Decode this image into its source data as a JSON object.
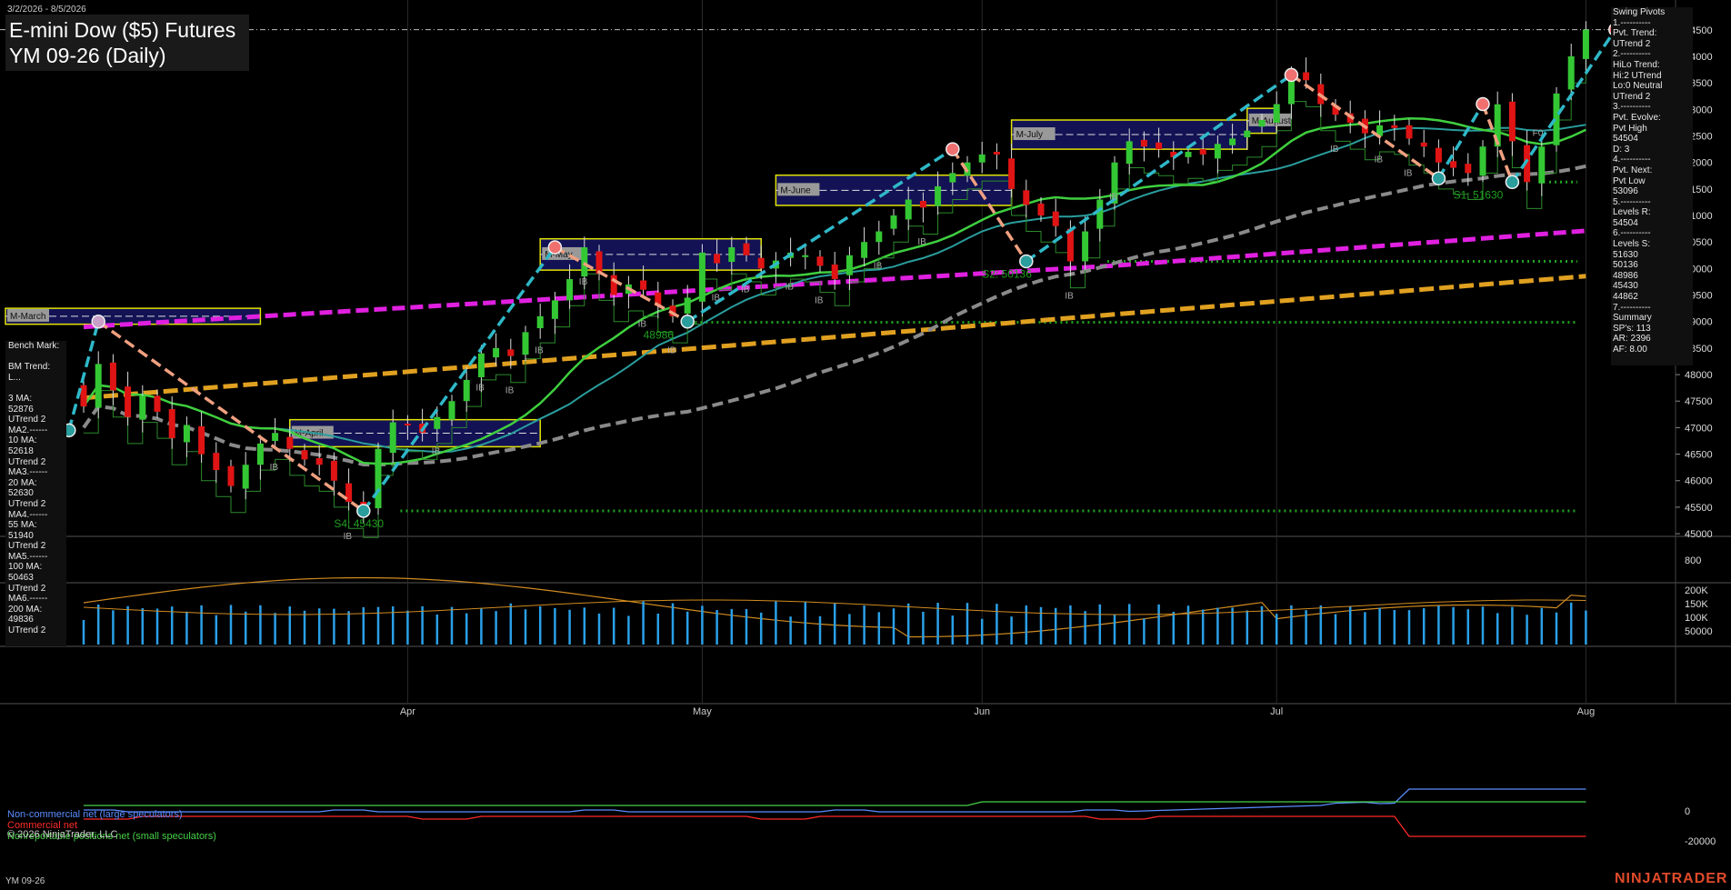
{
  "header": {
    "date_range": "3/2/2026 - 8/5/2026",
    "title": "E-mini Dow ($5) Futures",
    "subtitle": "YM 09-26 (Daily)"
  },
  "footer": {
    "symbol": "YM 09-26",
    "copyright": "© 2026 NinjaTrader, LLC",
    "brand": "NINJATRADER"
  },
  "swing_pivots_panel": {
    "lines": [
      "Swing Pivots",
      "1.----------",
      "Pvt. Trend:",
      "UTrend 2",
      "2.----------",
      "HiLo Trend:",
      "Hi:2 UTrend",
      "Lo:0 Neutral",
      "UTrend 2",
      "3.----------",
      "Pvt. Evolve:",
      "Pvt High",
      "54504",
      "D: 3",
      "4.----------",
      "Pvt. Next:",
      "Pvt Low",
      "53096",
      "5.----------",
      "Levels R:",
      "54504",
      "6.----------",
      "Levels S:",
      "51630",
      "50136",
      "48986",
      "45430",
      "44862",
      "7.----------",
      "Summary",
      "SP's: 113",
      "AR: 2396",
      "AF: 8.00"
    ]
  },
  "bench_panel": {
    "lines": [
      "Bench Mark:",
      "",
      "BM Trend:",
      "L...",
      "",
      "3 MA:",
      "52876",
      "UTrend 2",
      "MA2.------",
      "10 MA:",
      "52618",
      "UTrend 2",
      "MA3.------",
      "20 MA:",
      "52630",
      "UTrend 2",
      "MA4.------",
      "55 MA:",
      "51940",
      "UTrend 2",
      "MA5.------",
      "100 MA:",
      "50463",
      "UTrend 2",
      "MA6.------",
      "200 MA:",
      "49836",
      "UTrend 2"
    ]
  },
  "cot_legend": {
    "noncommercial": "Non-commercial net (large speculators)",
    "commercial": "Commercial net",
    "nonreportable": "Nonreportable positions net (small speculators)"
  },
  "colors": {
    "up_candle": "#34c734",
    "down_candle": "#e01414",
    "ma_green": "#3fcf3f",
    "ma_teal": "#2a9d9d",
    "ma_gray": "#8a8a8a",
    "ma_magenta": "#e020e0",
    "ma_orange": "#e0a020",
    "trend_cyan": "#2fb8c8",
    "trend_salmon": "#f0a080",
    "box_border": "#f0f000",
    "box_fill": "#14145a",
    "support": "#1f9f1f",
    "volume": "#2aa0e8",
    "atr": "#d08a20"
  },
  "chart_data": {
    "type": "candlestick",
    "title": "YM 09-26 (Daily)",
    "x_ticks": [
      {
        "label": "Apr",
        "index": 22
      },
      {
        "label": "May",
        "index": 42
      },
      {
        "label": "Jun",
        "index": 61
      },
      {
        "label": "Jul",
        "index": 81
      },
      {
        "label": "Aug",
        "index": 102
      }
    ],
    "n_bars": 105,
    "price_axis": {
      "min": 45100,
      "max": 55000,
      "ticks": [
        45000,
        45500,
        46000,
        46500,
        47000,
        47500,
        48000,
        48500,
        49000,
        49500,
        50000,
        50500,
        51000,
        51500,
        52000,
        52500,
        53000,
        53500,
        54000,
        54500
      ]
    },
    "current_price_line": 54504,
    "closes": [
      47400,
      48200,
      47700,
      47200,
      47600,
      47300,
      46800,
      47050,
      46500,
      46200,
      45900,
      46300,
      46700,
      46900,
      46600,
      46400,
      46300,
      46000,
      45600,
      45430,
      46600,
      47100,
      47050,
      46900,
      47200,
      47500,
      47900,
      48400,
      48500,
      48350,
      48800,
      49100,
      49400,
      49800,
      50400,
      49900,
      49500,
      49700,
      49600,
      49300,
      49100,
      49450,
      50300,
      50100,
      50400,
      50250,
      50000,
      50150,
      50300,
      50250,
      50050,
      49800,
      50250,
      50500,
      50700,
      51000,
      51300,
      51150,
      51550,
      51800,
      52000,
      52150,
      52150,
      51500,
      51200,
      51000,
      50800,
      50136,
      50700,
      51300,
      52000,
      52400,
      52300,
      52250,
      52100,
      52200,
      52150,
      52350,
      52450,
      52600,
      52800,
      53100,
      53650,
      53550,
      53100,
      52900,
      52750,
      52550,
      52700,
      52650,
      52450,
      52300,
      52000,
      51900,
      51800,
      52300,
      53096,
      52400,
      51630,
      52300,
      53300,
      54000,
      54504
    ],
    "volume_axis": {
      "ticks": [
        "200K",
        "150K",
        "100K",
        "50000"
      ]
    },
    "atr_axis": {
      "ticks": [
        "800"
      ]
    },
    "cot_axis": {
      "ticks": [
        "0",
        "-20000"
      ]
    },
    "price_labels": [
      {
        "text": "S4: 45430",
        "value": 45430
      },
      {
        "text": "S2: 50136",
        "value": 50136
      },
      {
        "text": "S1: 51630",
        "value": 51630
      },
      {
        "text": "48986",
        "value": 48986
      }
    ],
    "box_labels": [
      "M-March",
      "M-April",
      "M-May",
      "M-June",
      "M-July",
      "M-August"
    ],
    "ib_label": "IB",
    "fo_label": "F0"
  }
}
